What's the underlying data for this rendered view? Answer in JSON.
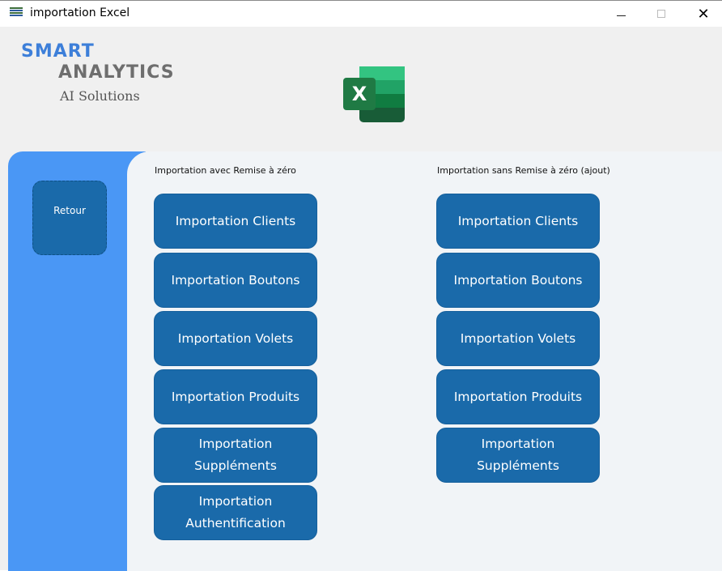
{
  "window": {
    "title": "importation Excel",
    "minimize_icon": "minimize-icon",
    "maximize_icon": "maximize-icon",
    "close_symbol": "✕"
  },
  "branding": {
    "line1": "SMART",
    "line2": "ANALYTICS",
    "line3": "AI Solutions",
    "excel_letter": "X",
    "colors": {
      "smart": "#3d7fd9",
      "analytics": "#6e6e6e",
      "excel_green": "#1f7a44"
    }
  },
  "sidebar": {
    "retour_label": "Retour",
    "color": "#4a97f5"
  },
  "sections": {
    "left": {
      "label": "Importation avec Remise à zéro",
      "buttons": [
        {
          "label": "Importation Clients"
        },
        {
          "label": "Importation Boutons"
        },
        {
          "label": "Importation Volets"
        },
        {
          "label": "Importation Produits"
        },
        {
          "label": "Importation\nSuppléments"
        },
        {
          "label": "Importation\nAuthentification"
        }
      ]
    },
    "right": {
      "label": "Importation sans Remise à zéro (ajout)",
      "buttons": [
        {
          "label": "Importation Clients"
        },
        {
          "label": "Importation Boutons"
        },
        {
          "label": "Importation Volets"
        },
        {
          "label": "Importation Produits"
        },
        {
          "label": "Importation\nSuppléments"
        }
      ]
    }
  },
  "colors": {
    "button": "#1a6aaa",
    "button_text": "#ffffff",
    "panel": "#f1f4f7"
  }
}
